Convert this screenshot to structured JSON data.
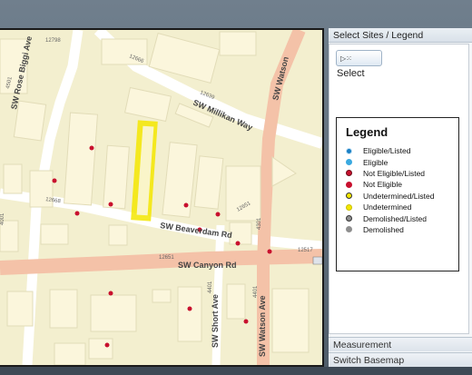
{
  "panel": {
    "header": "Select Sites / Legend",
    "select_button": "Select",
    "select_icon": "pointer-cursor-icon",
    "tabs": [
      "Measurement",
      "Switch Basemap"
    ]
  },
  "legend": {
    "title": "Legend",
    "items": [
      {
        "label": "Eligible/Listed",
        "color": "#1a7fc4",
        "symbol": "dot-ringed"
      },
      {
        "label": "Eligible",
        "color": "#3aa9e0",
        "symbol": "dot"
      },
      {
        "label": "Not Eligible/Listed",
        "color": "#c8102e",
        "symbol": "dot-ringed"
      },
      {
        "label": "Not Eligible",
        "color": "#c8102e",
        "symbol": "dot"
      },
      {
        "label": "Undetermined/Listed",
        "color": "#f3e600",
        "symbol": "dot-ringed"
      },
      {
        "label": "Undetermined",
        "color": "#f3e600",
        "symbol": "dot"
      },
      {
        "label": "Demolished/Listed",
        "color": "#8f8f8f",
        "symbol": "dot-ringed"
      },
      {
        "label": "Demolished",
        "color": "#8f8f8f",
        "symbol": "dot"
      }
    ]
  },
  "map": {
    "street_labels": {
      "millikan": "SW Millikan Way",
      "beaverdam": "SW Beaverdam Rd",
      "canyon": "SW Canyon Rd",
      "rose_biggi": "SW Rose Biggi Ave",
      "watson_top": "SW Watson",
      "short": "SW Short Ave",
      "watson_bottom": "SW Watson Ave"
    },
    "address_labels": {
      "a1": "12798",
      "a2": "12666",
      "a3": "12639",
      "a4": "12668",
      "a5": "12651",
      "a6": "12517",
      "a7": "12651",
      "a8": "4501",
      "a9": "4001",
      "a10": "4401",
      "a11": "4401",
      "a12": "4301"
    },
    "colors": {
      "background": "#f3efcf",
      "building": "#fbf6dc",
      "road": "#ffffff",
      "arterial": "#f4c2a8",
      "highlight": "#f3e600",
      "site": "#c8102e"
    }
  }
}
